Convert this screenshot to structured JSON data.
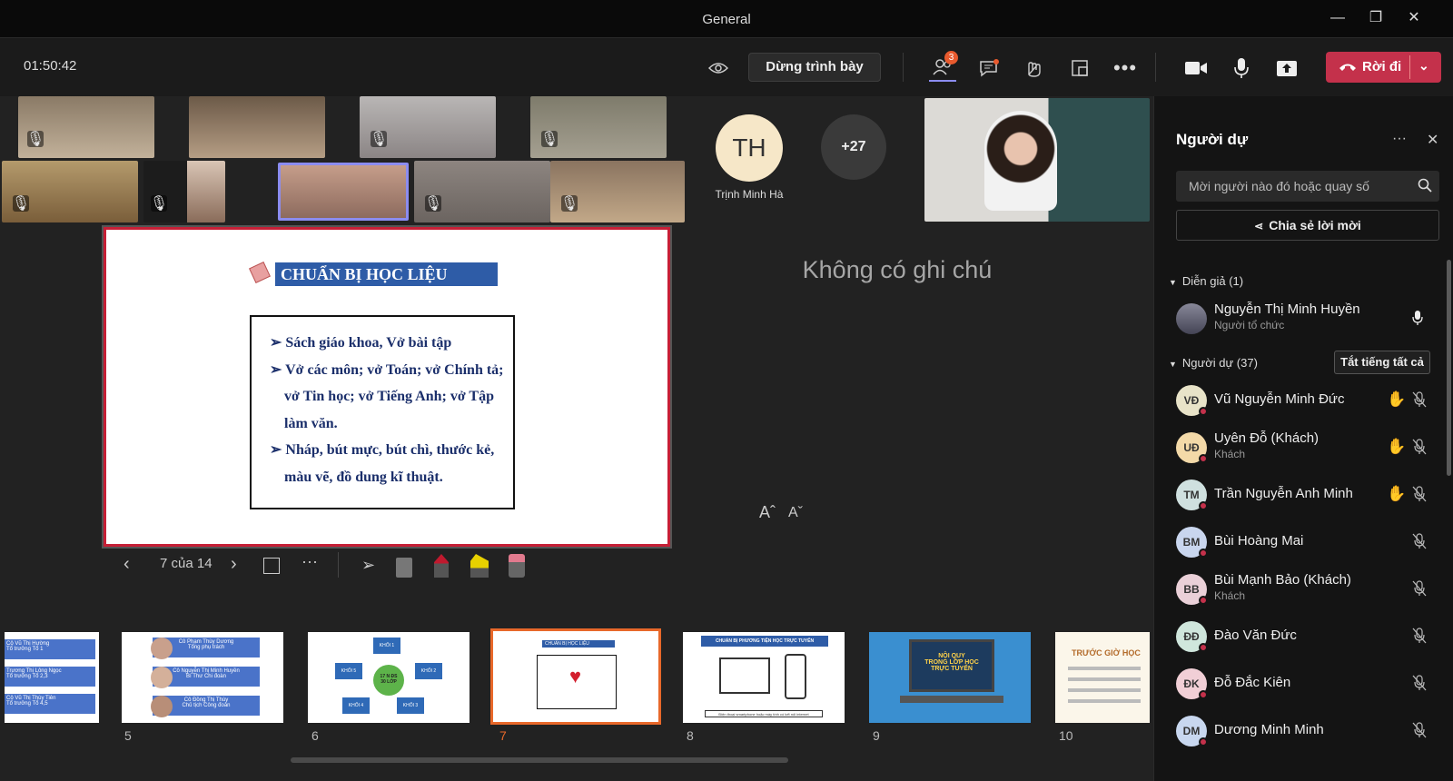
{
  "window": {
    "title": "General",
    "minimize": "—",
    "restore": "❐",
    "close": "✕"
  },
  "toolbar": {
    "timer": "01:50:42",
    "stop_presenting": "Dừng trình bày",
    "participants_badge": "3",
    "leave": "Rời đi"
  },
  "gallery": {
    "participant_name": "Trịnh Minh Hà",
    "participant_initials": "TH",
    "overflow": "+27"
  },
  "slide": {
    "title": "CHUẨN BỊ HỌC LIỆU",
    "lines": [
      "➢ Sách giáo khoa, Vở bài tập",
      "➢ Vở các môn; vở Toán; vở Chính tả;",
      "vở Tin học; vở Tiếng Anh; vở Tập",
      "làm văn.",
      "➢ Nháp, bút mực, bút chì, thước kẻ,",
      "màu vẽ, đồ dung kĩ thuật."
    ],
    "counter": "7 của 14"
  },
  "notes": {
    "empty": "Không có ghi chú",
    "font_up": "Aˆ",
    "font_down": "Aˇ"
  },
  "thumbnails": [
    {
      "num": "",
      "lines": [
        "Cô Vũ Thị Hường",
        "Tổ trưởng Tổ 1",
        "Trương Thị Lông Ngọc",
        "Tổ trưởng Tổ 2,3",
        "Cô Vũ Thị Thùy Tiên",
        "Tổ trưởng Tổ 4,5"
      ]
    },
    {
      "num": "5",
      "lines": [
        "Cô Phạm Thùy Dương",
        "Tổng phụ trách",
        "Cô Nguyễn Thị Minh Huyền",
        "Bí Thư Chi đoàn",
        "Cô Đồng Thị Thùy",
        "Chủ tịch Công đoàn"
      ]
    },
    {
      "num": "6",
      "lines": [
        "17 N ĐS",
        "30 LỚP",
        "KHỐI 1",
        "KHỐI 2",
        "KHỐI 3",
        "KHỐI 4",
        "KHỐI 5"
      ]
    },
    {
      "num": "7",
      "lines": [
        "CHUẨN BỊ HỌC LIỆU"
      ]
    },
    {
      "num": "8",
      "lines": [
        "CHUẨN BỊ PHƯƠNG TIỆN HỌC TRỰC TUYẾN",
        "Điện thoại smartphone hoặc máy tính có kết nối internet"
      ]
    },
    {
      "num": "9",
      "lines": [
        "NỘI QUY",
        "TRONG LỚP HỌC",
        "TRỰC TUYẾN"
      ]
    },
    {
      "num": "10",
      "lines": [
        "TRƯỚC GIỜ HỌC"
      ]
    }
  ],
  "panel": {
    "title": "Người dự",
    "invite_placeholder": "Mời người nào đó hoặc quay số",
    "share_invite": "Chia sẻ lời mời",
    "presenters_header": "Diễn giả (1)",
    "presenter": {
      "name": "Nguyễn Thị Minh Huyền",
      "role": "Người tổ chức"
    },
    "attendees_header": "Người dự (37)",
    "mute_all": "Tắt tiếng tất cả",
    "attendees": [
      {
        "initials": "VĐ",
        "name": "Vũ Nguyễn Minh Đức",
        "sub": "",
        "hand": "✋",
        "color": "#e8e3c8"
      },
      {
        "initials": "UĐ",
        "name": "Uyên Đỗ (Khách)",
        "sub": "Khách",
        "hand": "✋",
        "color": "#f3d9a8"
      },
      {
        "initials": "TM",
        "name": "Trần Nguyễn Anh Minh",
        "sub": "",
        "hand": "✋",
        "color": "#cfe0df"
      },
      {
        "initials": "BM",
        "name": "Bùi Hoàng Mai",
        "sub": "",
        "hand": "",
        "color": "#c9d6ee"
      },
      {
        "initials": "BB",
        "name": "Bùi Mạnh Bảo (Khách)",
        "sub": "Khách",
        "hand": "",
        "color": "#ead0d8"
      },
      {
        "initials": "ĐĐ",
        "name": "Đào Văn Đức",
        "sub": "",
        "hand": "",
        "color": "#cfe6dc"
      },
      {
        "initials": "ĐK",
        "name": "Đỗ Đắc Kiên",
        "sub": "",
        "hand": "",
        "color": "#f1cfd6"
      },
      {
        "initials": "DM",
        "name": "Dương Minh Minh",
        "sub": "",
        "hand": "",
        "color": "#c8d7ef"
      }
    ]
  },
  "colors": {
    "accent": "#c4314b",
    "slide_title": "#2e5ca7",
    "hand": "#f0b400"
  }
}
